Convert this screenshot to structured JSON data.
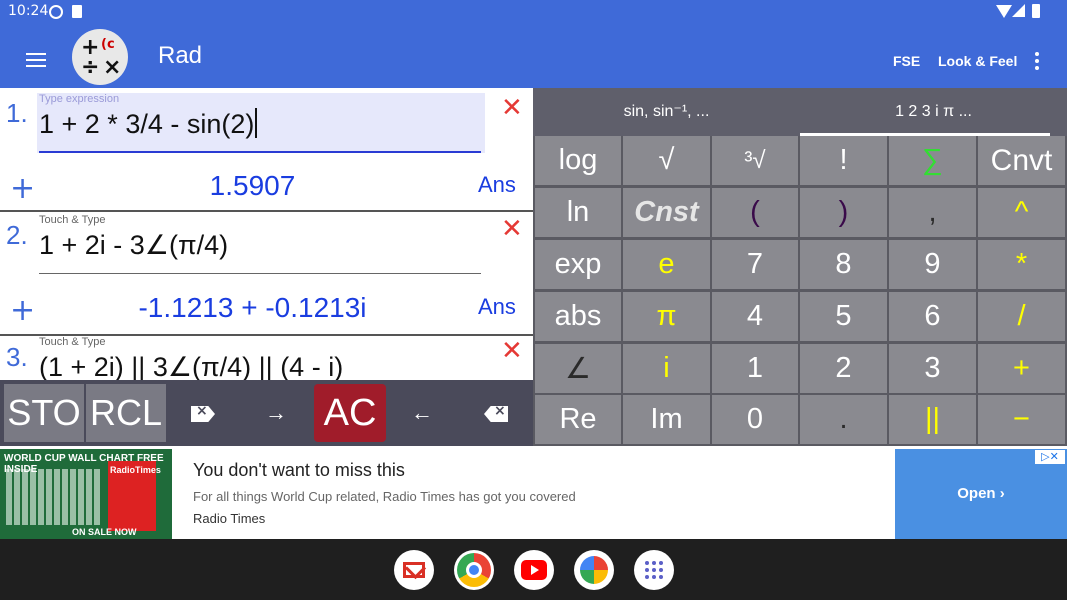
{
  "status_bar": {
    "time": "10:24"
  },
  "app_bar": {
    "mode": "Rad",
    "fse_label": "FSE",
    "look_feel_label": "Look & Feel"
  },
  "history": [
    {
      "index": "1.",
      "hint": "Type expression",
      "expression": "1 + 2 * 3/4 - sin(2)",
      "result": "1.5907",
      "ans_label": "Ans"
    },
    {
      "index": "2.",
      "hint": "Touch & Type",
      "expression": "1 + 2i - 3∠(π/4)",
      "result": "-1.1213 + -0.1213i",
      "ans_label": "Ans"
    },
    {
      "index": "3.",
      "hint": "Touch & Type",
      "expression": "(1 + 2i) || 3∠(π/4) || (4 - i)"
    }
  ],
  "toolbar": {
    "sto_label": "STO",
    "rcl_label": "RCL",
    "ac_label": "AC",
    "right_arrow": "→",
    "left_arrow": "←"
  },
  "keypad_tabs": [
    {
      "label": "sin, sin⁻¹, ..."
    },
    {
      "label": "1 2 3 i π ..."
    }
  ],
  "keys": [
    [
      "log",
      "√",
      "³√",
      "!",
      "∑",
      "Cnvt"
    ],
    [
      "ln",
      "Cnst",
      "(",
      ")",
      ",",
      "^"
    ],
    [
      "exp",
      "e",
      "7",
      "8",
      "9",
      "*"
    ],
    [
      "abs",
      "π",
      "4",
      "5",
      "6",
      "/"
    ],
    [
      "∠",
      "i",
      "1",
      "2",
      "3",
      "+"
    ],
    [
      "Re",
      "Im",
      "0",
      ".",
      "||",
      "−"
    ]
  ],
  "ad": {
    "image_banner": "WORLD CUP WALL CHART FREE INSIDE",
    "image_magazine": "RadioTimes",
    "image_sale": "ON SALE NOW",
    "title": "You don't want to miss this",
    "subtitle": "For all things World Cup related, Radio Times has got you covered",
    "advertiser": "Radio Times",
    "cta": "Open ›"
  },
  "colors": {
    "primary": "#3f6ad8",
    "result_blue": "#1a3de0",
    "ac_red": "#a01c2a",
    "key_yellow": "#ffff00",
    "sigma_green": "#33dd33"
  },
  "icons": {
    "menu": "menu-icon",
    "more": "more-vert-icon",
    "close": "close-icon",
    "plus": "add-icon",
    "backspace_left": "backspace-icon",
    "backspace_right": "backspace-icon"
  }
}
